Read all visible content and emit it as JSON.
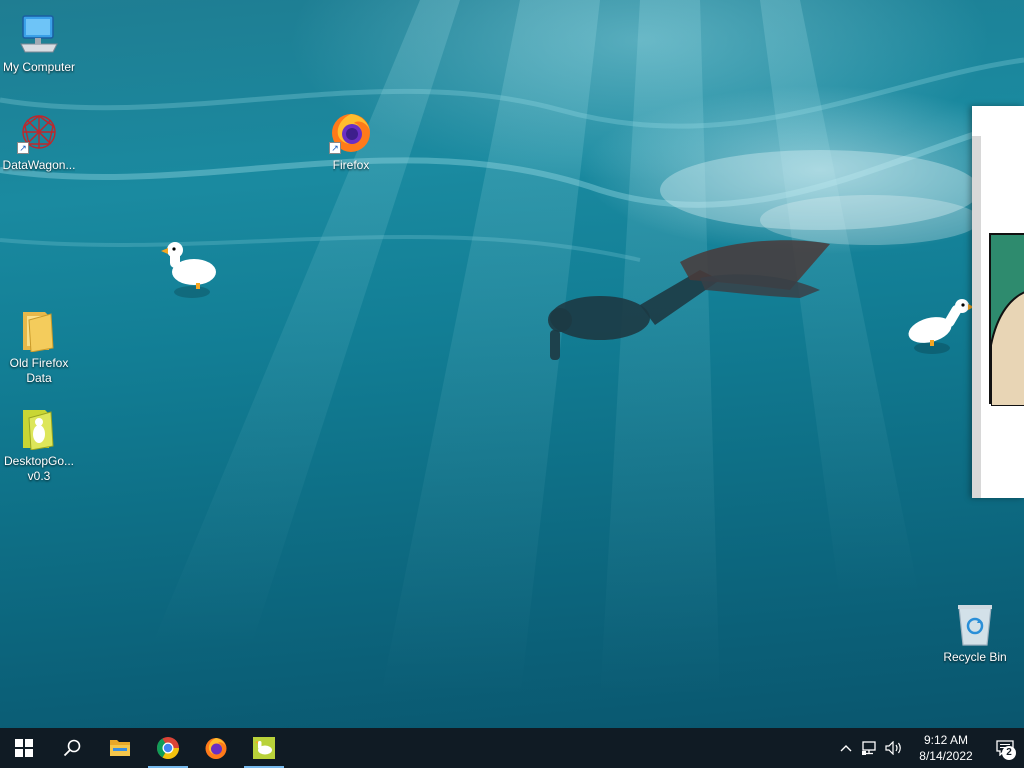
{
  "desktop": {
    "icons": [
      {
        "id": "my-computer",
        "label": "My Computer",
        "icon": "computer-icon"
      },
      {
        "id": "datawagon",
        "label": "DataWagon...",
        "icon": "datawagon-icon"
      },
      {
        "id": "firefox",
        "label": "Firefox",
        "icon": "firefox-icon"
      },
      {
        "id": "old-firefox-data",
        "label": "Old Firefox Data",
        "icon": "folder-icon"
      },
      {
        "id": "desktop-goose",
        "label": "DesktopGo... v0.3",
        "icon": "goose-folder-icon"
      },
      {
        "id": "recycle-bin",
        "label": "Recycle Bin",
        "icon": "recycle-bin-icon"
      }
    ]
  },
  "taskbar": {
    "start_icon": "windows-logo-icon",
    "search_icon": "search-icon",
    "pinned": [
      {
        "name": "file-explorer",
        "icon": "folder-icon",
        "active": false
      },
      {
        "name": "chrome",
        "icon": "chrome-icon",
        "active": true
      },
      {
        "name": "firefox",
        "icon": "firefox-icon",
        "active": false
      },
      {
        "name": "desktop-goose",
        "icon": "goose-icon",
        "active": true
      }
    ],
    "clock": {
      "time": "9:12 AM",
      "date": "8/14/2022"
    },
    "notification_count": "2"
  },
  "colors": {
    "taskbar_bg": "#101b24",
    "active_indicator": "#76b9ed"
  }
}
